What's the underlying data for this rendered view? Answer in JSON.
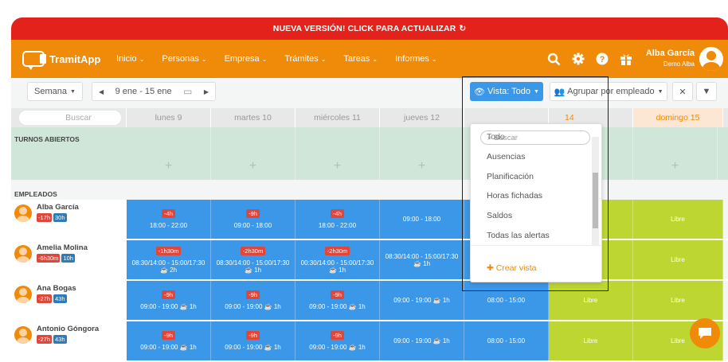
{
  "banner": {
    "text": "NUEVA VERSIÓN! CLICK PARA ACTUALIZAR",
    "icon": "↻"
  },
  "nav": {
    "logo": "TramitApp",
    "menu": [
      {
        "label": "Inicio"
      },
      {
        "label": "Personas"
      },
      {
        "label": "Empresa"
      },
      {
        "label": "Trámites"
      },
      {
        "label": "Tareas"
      },
      {
        "label": "Informes"
      }
    ],
    "user_name": "Alba García",
    "user_sub": "Demo Alba"
  },
  "toolbar": {
    "period": "Semana",
    "range": "9 ene - 15 ene",
    "view": "Vista: Todo",
    "group": "Agrupar por empleado"
  },
  "grid": {
    "search_placeholder": "Buscar",
    "days": [
      "lunes 9",
      "martes 10",
      "miércoles 11",
      "jueves 12",
      "",
      "14",
      "domingo 15"
    ],
    "open_label": "TURNOS ABIERTOS",
    "emp_label": "EMPLEADOS",
    "plus": "+"
  },
  "employees": [
    {
      "name": "Alba García",
      "t1": "-17h",
      "t2": "30h",
      "cells": [
        {
          "b": "-4h",
          "t": "18:00 - 22:00"
        },
        {
          "b": "-9h",
          "t": "09:00 - 18:00"
        },
        {
          "b": "-4h",
          "t": "18:00 - 22:00"
        },
        {
          "b": "",
          "t": "09:00 - 18:00"
        },
        {
          "b": "",
          "t": ""
        },
        {
          "b": "",
          "t": "",
          "free": true
        },
        {
          "b": "",
          "t": "Libre",
          "free": true
        }
      ]
    },
    {
      "name": "Amelia Molina",
      "t1": "-6h30m",
      "t2": "10h",
      "cells": [
        {
          "b": "-1h30m",
          "t": "08:30/14:00 - 15:00/17:30",
          "s": "☕ 2h"
        },
        {
          "b": "-2h30m",
          "t": "08:30/14:00 - 15:00/17:30",
          "s": "☕ 1h"
        },
        {
          "b": "-2h30m",
          "t": "00:30/14:00 - 15:00/17:30",
          "s": "☕ 1h"
        },
        {
          "b": "",
          "t": "08:30/14:00 - 15:00/17:30",
          "s": "☕ 1h"
        },
        {
          "b": "",
          "t": ""
        },
        {
          "b": "",
          "t": "",
          "free": true
        },
        {
          "b": "",
          "t": "Libre",
          "free": true
        }
      ]
    },
    {
      "name": "Ana Bogas",
      "t1": "-27h",
      "t2": "43h",
      "cells": [
        {
          "b": "-9h",
          "t": "09:00 - 19:00 ☕ 1h"
        },
        {
          "b": "-9h",
          "t": "09:00 - 19:00 ☕ 1h"
        },
        {
          "b": "-9h",
          "t": "09:00 - 19:00 ☕ 1h"
        },
        {
          "b": "",
          "t": "09:00 - 19:00 ☕ 1h"
        },
        {
          "b": "",
          "t": "08:00 - 15:00"
        },
        {
          "b": "",
          "t": "Libre",
          "free": true
        },
        {
          "b": "",
          "t": "Libre",
          "free": true
        }
      ]
    },
    {
      "name": "Antonio Góngora",
      "t1": "-27h",
      "t2": "43h",
      "cells": [
        {
          "b": "-9h",
          "t": "09:00 - 19:00 ☕ 1h"
        },
        {
          "b": "-9h",
          "t": "09:00 - 19:00 ☕ 1h"
        },
        {
          "b": "-9h",
          "t": "09:00 - 19:00 ☕ 1h"
        },
        {
          "b": "",
          "t": "09:00 - 19:00 ☕ 1h"
        },
        {
          "b": "",
          "t": "08:00 - 15:00"
        },
        {
          "b": "",
          "t": "Libre",
          "free": true
        },
        {
          "b": "",
          "t": "Libre",
          "free": true
        }
      ]
    }
  ],
  "dropdown": {
    "search": "Buscar",
    "items": [
      "Todo",
      "Ausencias",
      "Planificación",
      "Horas fichadas",
      "Saldos",
      "Todas las alertas"
    ],
    "create": "Crear vista"
  }
}
